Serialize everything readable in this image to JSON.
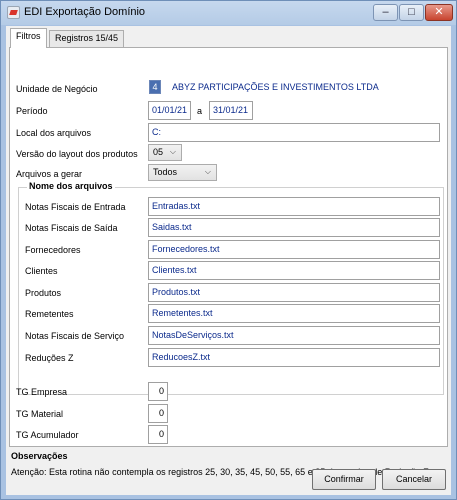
{
  "window": {
    "title": "EDI Exportação Domínio",
    "minimize_glyph": "–",
    "maximize_glyph": "□",
    "close_glyph": "✕"
  },
  "tabs": [
    {
      "label": "Filtros",
      "active": true
    },
    {
      "label": "Registros 15/45",
      "active": false
    }
  ],
  "filters": {
    "business_unit_label": "Unidade de Negócio",
    "business_unit_code": "4",
    "business_unit_name": "ABYZ PARTICIPAÇÕES E INVESTIMENTOS LTDA",
    "period_label": "Período",
    "period_start": "01/01/21",
    "period_separator": "a",
    "period_end": "31/01/21",
    "location_label": "Local dos arquivos",
    "location_value": "C:",
    "layout_version_label": "Versão do layout dos produtos",
    "layout_version_value": "05",
    "files_to_generate_label": "Arquivos a gerar",
    "files_to_generate_value": "Todos"
  },
  "file_names": {
    "group_title": "Nome dos arquivos",
    "rows": [
      {
        "label": "Notas Fiscais de Entrada",
        "value": "Entradas.txt"
      },
      {
        "label": "Notas Fiscais de Saída",
        "value": "Saidas.txt"
      },
      {
        "label": "Fornecedores",
        "value": "Fornecedores.txt"
      },
      {
        "label": "Clientes",
        "value": "Clientes.txt"
      },
      {
        "label": "Produtos",
        "value": "Produtos.txt"
      },
      {
        "label": "Remetentes",
        "value": "Remetentes.txt"
      },
      {
        "label": "Notas Fiscais de Serviço",
        "value": "NotasDeServiços.txt"
      },
      {
        "label": "Reduções Z",
        "value": "ReducoesZ.txt"
      }
    ]
  },
  "tg": [
    {
      "label": "TG Empresa",
      "value": "0"
    },
    {
      "label": "TG Material",
      "value": "0"
    },
    {
      "label": "TG Acumulador",
      "value": "0"
    }
  ],
  "observations": {
    "title": "Observações",
    "text": "Atenção: Esta rotina não contempla os registros  25, 30, 35, 45, 50, 55, 65 e 85 do arquivo de Redução Z."
  },
  "buttons": {
    "confirm": "Confirmar",
    "cancel": "Cancelar"
  }
}
